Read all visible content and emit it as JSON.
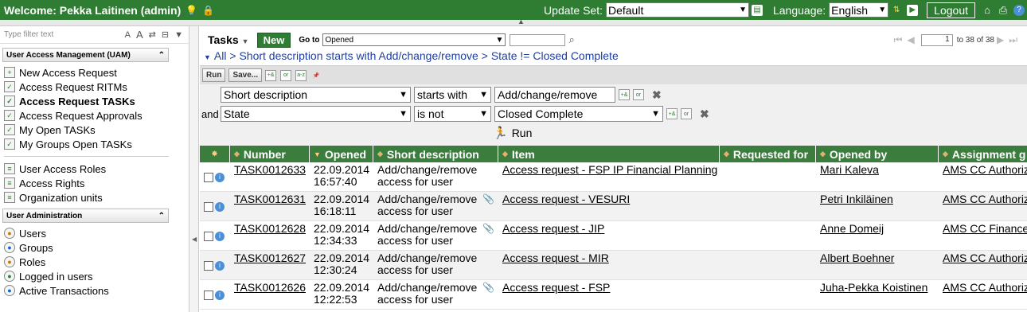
{
  "topbar": {
    "welcome": "Welcome: Pekka Laitinen (admin)",
    "update_set_label": "Update Set:",
    "update_set_value": "Default",
    "language_label": "Language:",
    "language_value": "English",
    "logout_label": "Logout",
    "color": "#2e7d32"
  },
  "sidebar": {
    "filter_placeholder": "Type filter text",
    "filter_icons": [
      "A",
      "A",
      "⇄",
      "⊟",
      "▼"
    ],
    "sections": [
      {
        "title": "User Access Management (UAM)",
        "items": [
          {
            "label": "New Access Request",
            "icon": "add-doc-icon"
          },
          {
            "label": "Access Request RITMs",
            "icon": "doc-check-icon"
          },
          {
            "label": "Access Request TASKs",
            "icon": "doc-check-icon",
            "bold": true
          },
          {
            "label": "Access Request Approvals",
            "icon": "doc-check-icon"
          },
          {
            "label": "My Open TASKs",
            "icon": "doc-check-icon"
          },
          {
            "label": "My Groups Open TASKs",
            "icon": "doc-check-icon"
          }
        ]
      },
      {
        "title": "",
        "items": [
          {
            "label": "User Access Roles",
            "icon": "doc-icon"
          },
          {
            "label": "Access Rights",
            "icon": "doc-icon"
          },
          {
            "label": "Organization units",
            "icon": "doc-icon"
          }
        ]
      },
      {
        "title": "User Administration",
        "items": [
          {
            "label": "Users",
            "icon": "user-icon"
          },
          {
            "label": "Groups",
            "icon": "group-icon"
          },
          {
            "label": "Roles",
            "icon": "role-icon"
          },
          {
            "label": "Logged in users",
            "icon": "user-icon"
          },
          {
            "label": "Active Transactions",
            "icon": "user-icon"
          }
        ]
      }
    ]
  },
  "list": {
    "title": "Tasks",
    "new_label": "New",
    "goto_label": "Go to",
    "goto_field": "Opened",
    "pager": {
      "current": "1",
      "text": "to 38 of 38"
    },
    "breadcrumb": [
      "All",
      "Short description starts with Add/change/remove",
      "State != Closed Complete"
    ],
    "toolbar": {
      "run": "Run",
      "save": "Save..."
    },
    "conditions": [
      {
        "prefix": "",
        "field": "Short description",
        "operator": "starts with",
        "value": "Add/change/remove"
      },
      {
        "prefix": "and",
        "field": "State",
        "operator": "is not",
        "value": "Closed Complete"
      }
    ],
    "run_label": "Run",
    "columns": [
      "Number",
      "Opened",
      "Short description",
      "Item",
      "Requested for",
      "Opened by",
      "Assignment g"
    ],
    "rows": [
      {
        "number": "TASK0012633",
        "opened_date": "22.09.2014",
        "opened_time": "16:57:40",
        "short_desc": "Add/change/remove access for user",
        "attachment": false,
        "item": "Access request - FSP IP Financial Planning",
        "requested_for": "",
        "opened_by": "Mari Kaleva",
        "assignment": "AMS CC Authoriz"
      },
      {
        "number": "TASK0012631",
        "opened_date": "22.09.2014",
        "opened_time": "16:18:11",
        "short_desc": "Add/change/remove access for user",
        "attachment": true,
        "item": "Access request - VESURI",
        "requested_for": "",
        "opened_by": "Petri Inkiläinen",
        "assignment": "AMS CC Authoriz"
      },
      {
        "number": "TASK0012628",
        "opened_date": "22.09.2014",
        "opened_time": "12:34:33",
        "short_desc": "Add/change/remove access for user",
        "attachment": true,
        "item": "Access request - JIP",
        "requested_for": "",
        "opened_by": "Anne Domeij",
        "assignment": "AMS CC Finance"
      },
      {
        "number": "TASK0012627",
        "opened_date": "22.09.2014",
        "opened_time": "12:30:24",
        "short_desc": "Add/change/remove access for user",
        "attachment": false,
        "item": "Access request - MIR",
        "requested_for": "",
        "opened_by": "Albert Boehner",
        "assignment": "AMS CC Authoriz"
      },
      {
        "number": "TASK0012626",
        "opened_date": "22.09.2014",
        "opened_time": "12:22:53",
        "short_desc": "Add/change/remove access for user",
        "attachment": true,
        "item": "Access request - FSP",
        "requested_for": "",
        "opened_by": "Juha-Pekka Koistinen",
        "assignment": "AMS CC Authoriz"
      }
    ]
  }
}
